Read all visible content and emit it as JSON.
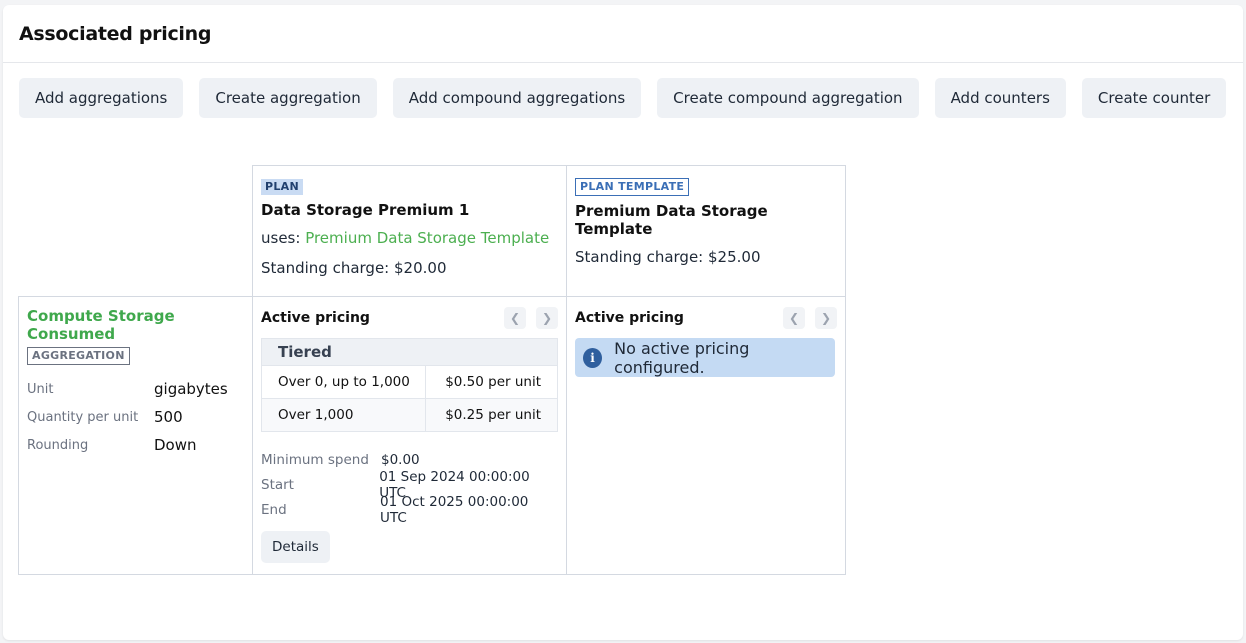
{
  "header": {
    "title": "Associated pricing"
  },
  "toolbar": {
    "buttons": [
      "Add aggregations",
      "Create aggregation",
      "Add compound aggregations",
      "Create compound aggregation",
      "Add counters",
      "Create counter"
    ]
  },
  "plans": [
    {
      "tag": "PLAN",
      "name": "Data Storage Premium 1",
      "uses_label": "uses: ",
      "uses_link": "Premium Data Storage Template",
      "standing_charge": "Standing charge: $20.00"
    },
    {
      "tag": "PLAN TEMPLATE",
      "name": "Premium Data Storage Template",
      "standing_charge": "Standing charge: $25.00"
    }
  ],
  "aggregation": {
    "name": "Compute Storage Consumed",
    "tag": "AGGREGATION",
    "props": [
      {
        "label": "Unit",
        "value": "gigabytes"
      },
      {
        "label": "Quantity per unit",
        "value": "500"
      },
      {
        "label": "Rounding",
        "value": "Down"
      }
    ]
  },
  "pricing": [
    {
      "title": "Active pricing",
      "tier_type": "Tiered",
      "tiers": [
        {
          "range": "Over 0, up to 1,000",
          "price": "$0.50 per unit"
        },
        {
          "range": "Over 1,000",
          "price": "$0.25 per unit"
        }
      ],
      "meta": [
        {
          "label": "Minimum spend",
          "value": "$0.00"
        },
        {
          "label": "Start",
          "value": "01 Sep 2024 00:00:00 UTC"
        },
        {
          "label": "End",
          "value": "01 Oct 2025 00:00:00 UTC"
        }
      ],
      "details_label": "Details"
    },
    {
      "title": "Active pricing",
      "message": "No active pricing configured."
    }
  ],
  "icons": {
    "prev": "chevron-left-icon",
    "next": "chevron-right-icon",
    "info": "info-icon"
  }
}
